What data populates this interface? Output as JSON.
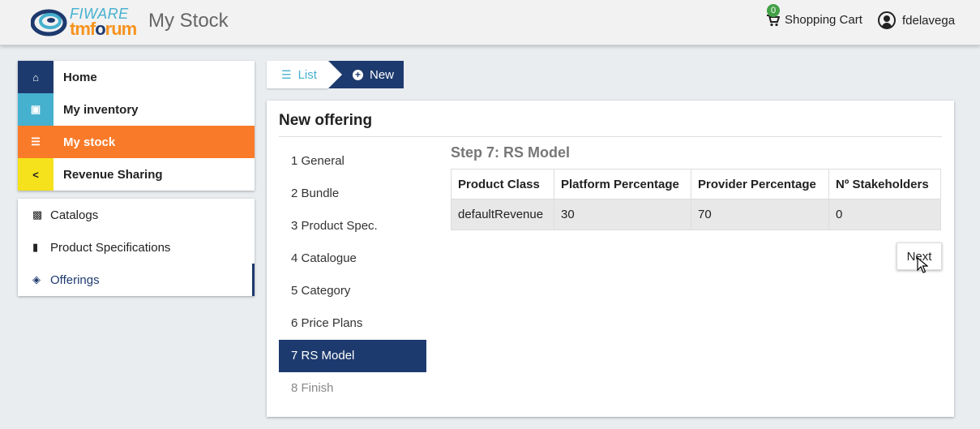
{
  "header": {
    "logo_top": "FIWARE",
    "logo_bottom_a": "tmf",
    "logo_bottom_b": "o",
    "logo_bottom_c": "rum",
    "title": "My Stock",
    "cart_count": "0",
    "cart_label": "Shopping Cart",
    "username": "fdelavega"
  },
  "nav": {
    "items": [
      {
        "label": "Home",
        "icon": "home-icon",
        "color": "#1d3a6e"
      },
      {
        "label": "My inventory",
        "icon": "archive-icon",
        "color": "#46b1cf"
      },
      {
        "label": "My stock",
        "icon": "database-icon",
        "color": "#f97b29"
      },
      {
        "label": "Revenue Sharing",
        "icon": "share-icon",
        "color": "#f5e11c"
      }
    ],
    "active": "My stock"
  },
  "subnav": {
    "items": [
      {
        "label": "Catalogs",
        "icon": "book-icon"
      },
      {
        "label": "Product Specifications",
        "icon": "file-icon"
      },
      {
        "label": "Offerings",
        "icon": "cube-icon"
      }
    ],
    "active": "Offerings"
  },
  "breadcrumb": {
    "list_label": "List",
    "new_label": "New"
  },
  "panel": {
    "title": "New offering",
    "steps": [
      "1 General",
      "2 Bundle",
      "3 Product Spec.",
      "4 Catalogue",
      "5 Category",
      "6 Price Plans",
      "7 RS Model",
      "8 Finish"
    ],
    "active_step": "7 RS Model",
    "step_title": "Step 7: RS Model",
    "table": {
      "headers": [
        "Product Class",
        "Platform Percentage",
        "Provider Percentage",
        "Nº Stakeholders"
      ],
      "rows": [
        [
          "defaultRevenue",
          "30",
          "70",
          "0"
        ]
      ]
    },
    "next_label": "Next"
  }
}
